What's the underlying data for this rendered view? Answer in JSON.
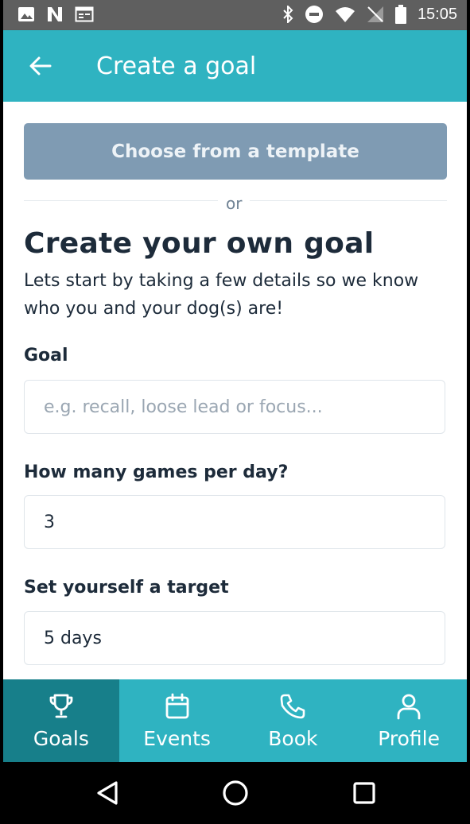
{
  "status_bar": {
    "time": "15:05"
  },
  "app_bar": {
    "title": "Create a goal"
  },
  "template_button": {
    "label": "Choose from a template"
  },
  "divider_text": "or",
  "heading": "Create your own goal",
  "intro": "Lets start by taking a few details so we know who you and your dog(s) are!",
  "form": {
    "goal": {
      "label": "Goal",
      "value": "",
      "placeholder": "e.g. recall, loose lead or focus..."
    },
    "games": {
      "label": "How many games per day?",
      "value": "3"
    },
    "target": {
      "label": "Set yourself a target",
      "value": "5 days"
    }
  },
  "bottom_nav": {
    "items": [
      {
        "label": "Goals",
        "icon": "trophy-icon",
        "active": true
      },
      {
        "label": "Events",
        "icon": "calendar-icon",
        "active": false
      },
      {
        "label": "Book",
        "icon": "phone-icon",
        "active": false
      },
      {
        "label": "Profile",
        "icon": "person-icon",
        "active": false
      }
    ]
  },
  "colors": {
    "primary": "#2fb3c1",
    "active_tab": "#177f8a",
    "template_button": "#7f9bb3",
    "text": "#1d2b3a"
  }
}
